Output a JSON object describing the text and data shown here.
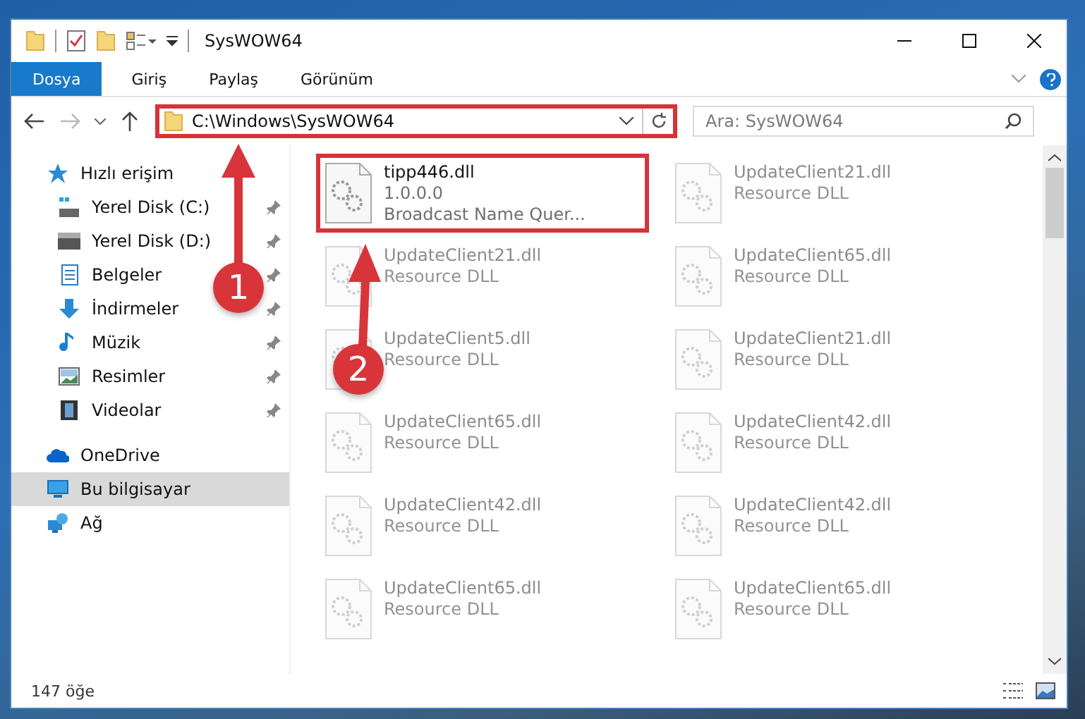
{
  "window": {
    "title": "SysWOW64"
  },
  "ribbon_tabs": [
    {
      "label": "Dosya",
      "selected": true
    },
    {
      "label": "Giriş",
      "selected": false
    },
    {
      "label": "Paylaş",
      "selected": false
    },
    {
      "label": "Görünüm",
      "selected": false
    }
  ],
  "address": {
    "path": "C:\\Windows\\SysWOW64",
    "highlighted": true
  },
  "search": {
    "placeholder": "Ara: SysWOW64"
  },
  "nav": [
    {
      "label": "Hızlı erişim",
      "selected": false,
      "children": [
        {
          "label": "Yerel Disk (C:)",
          "pinned": true
        },
        {
          "label": "Yerel Disk (D:)",
          "pinned": true
        },
        {
          "label": "Belgeler",
          "pinned": true
        },
        {
          "label": "İndirmeler",
          "pinned": true
        },
        {
          "label": "Müzik",
          "pinned": true
        },
        {
          "label": "Resimler",
          "pinned": true
        },
        {
          "label": "Videolar",
          "pinned": true
        }
      ]
    },
    {
      "label": "OneDrive",
      "selected": false
    },
    {
      "label": "Bu bilgisayar",
      "selected": true
    },
    {
      "label": "Ağ",
      "selected": false
    }
  ],
  "files": [
    {
      "name": "tipp446.dll",
      "lines": [
        "1.0.0.0",
        "Broadcast Name Quer..."
      ],
      "highlighted": true,
      "faded": false
    },
    {
      "name": "UpdateClient21.dll",
      "lines": [
        "Resource DLL"
      ],
      "highlighted": false,
      "faded": true
    },
    {
      "name": "UpdateClient21.dll",
      "lines": [
        "Resource DLL"
      ],
      "highlighted": false,
      "faded": true
    },
    {
      "name": "UpdateClient65.dll",
      "lines": [
        "Resource DLL"
      ],
      "highlighted": false,
      "faded": true
    },
    {
      "name": "UpdateClient5.dll",
      "lines": [
        "Resource DLL"
      ],
      "highlighted": false,
      "faded": true
    },
    {
      "name": "UpdateClient21.dll",
      "lines": [
        "Resource DLL"
      ],
      "highlighted": false,
      "faded": true
    },
    {
      "name": "UpdateClient65.dll",
      "lines": [
        "Resource DLL"
      ],
      "highlighted": false,
      "faded": true
    },
    {
      "name": "UpdateClient42.dll",
      "lines": [
        "Resource DLL"
      ],
      "highlighted": false,
      "faded": true
    },
    {
      "name": "UpdateClient42.dll",
      "lines": [
        "Resource DLL"
      ],
      "highlighted": false,
      "faded": true
    },
    {
      "name": "UpdateClient42.dll",
      "lines": [
        "Resource DLL"
      ],
      "highlighted": false,
      "faded": true
    },
    {
      "name": "UpdateClient65.dll",
      "lines": [
        "Resource DLL"
      ],
      "highlighted": false,
      "faded": true
    },
    {
      "name": "UpdateClient65.dll",
      "lines": [
        "Resource DLL"
      ],
      "highlighted": false,
      "faded": true
    }
  ],
  "status_bar": {
    "count": "147 öğe"
  },
  "annotations": [
    {
      "label": "1"
    },
    {
      "label": "2"
    }
  ]
}
